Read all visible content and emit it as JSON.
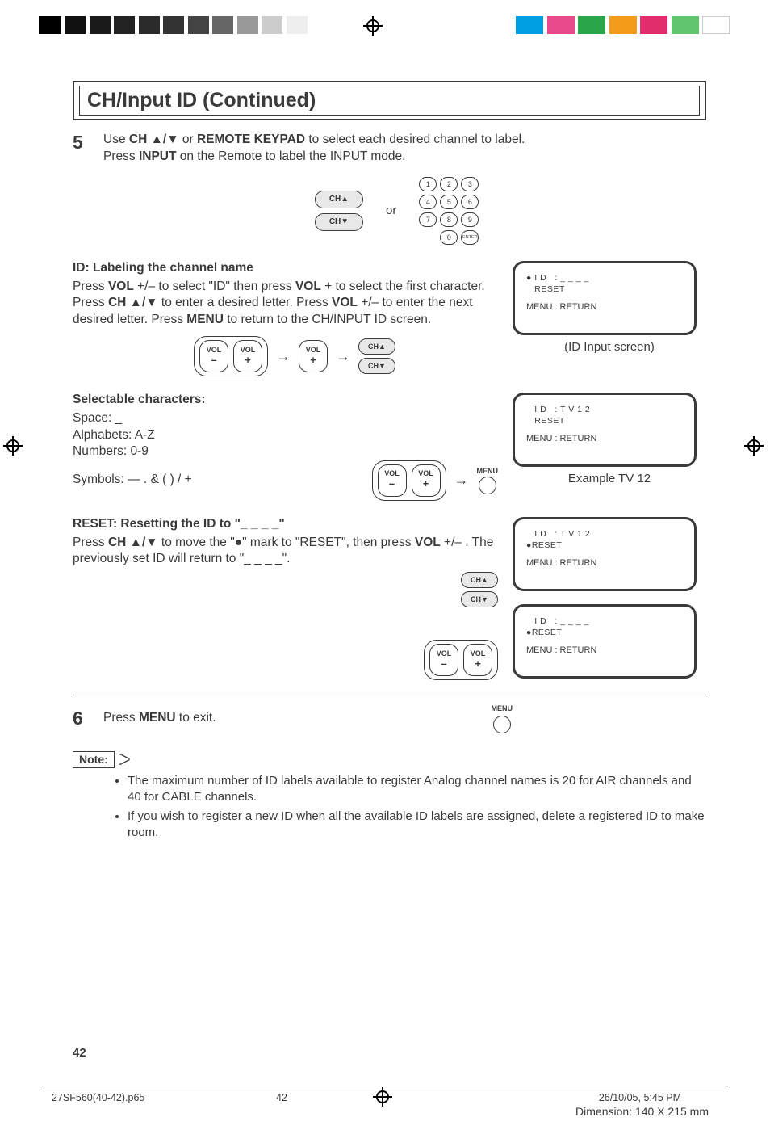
{
  "title": "CH/Input ID (Continued)",
  "step5": {
    "num": "5",
    "line1_a": "Use ",
    "line1_b": "CH ▲/▼",
    "line1_c": " or ",
    "line1_d": "REMOTE KEYPAD",
    "line1_e": " to select each desired channel to label.",
    "line2_a": "Press ",
    "line2_b": "INPUT",
    "line2_c": " on the Remote to label the INPUT mode."
  },
  "or_label": "or",
  "ch_up": "CH▲",
  "ch_dn": "CH▼",
  "keypad": [
    "1",
    "2",
    "3",
    "4",
    "5",
    "6",
    "7",
    "8",
    "9",
    "",
    "0",
    ""
  ],
  "key_enter": "ENTER",
  "id_label_heading": "ID: Labeling the channel name",
  "id_label_text_a": "Press ",
  "id_label_text_b": "VOL",
  "id_label_text_c": " +/– to select \"ID\" then press ",
  "id_label_text_d": "VOL",
  "id_label_text_e": " + to select the first character. Press ",
  "id_label_text_f": "CH ▲/▼",
  "id_label_text_g": " to enter a desired letter. Press ",
  "id_label_text_h": "VOL",
  "id_label_text_i": " +/– to enter the next desired letter. Press ",
  "id_label_text_j": "MENU",
  "id_label_text_k": " to return to the CH/INPUT ID screen.",
  "vol_label": "VOL",
  "plus": "+",
  "minus": "–",
  "screen_id_input": {
    "line1": "● I D   : _ _ _ _",
    "line2": "   RESET",
    "line3": "MENU : RETURN",
    "caption": "(ID Input screen)"
  },
  "selectable_heading": "Selectable characters:",
  "sel_space": "Space: _",
  "sel_alpha": "Alphabets: A-Z",
  "sel_num": "Numbers: 0-9",
  "sel_sym": "Symbols: — . & ( ) / +",
  "menu_label": "MENU",
  "screen_example": {
    "line1": "   I D   : T V 1 2",
    "line2": "   RESET",
    "line3": "MENU : RETURN",
    "caption": "Example TV 12"
  },
  "reset_heading": "RESET: Resetting the ID to \"_ _ _ _\"",
  "reset_text_a": "Press ",
  "reset_text_b": "CH ▲/▼",
  "reset_text_c": " to move the \"●\" mark to \"RESET\", then press ",
  "reset_text_d": "VOL",
  "reset_text_e": " +/– . The previously set ID will return to \"_ _ _ _\".",
  "screen_reset1": {
    "line1": "   I D   : T V 1 2",
    "line2": "●RESET",
    "line3": "MENU : RETURN"
  },
  "screen_reset2": {
    "line1": "   I D   : _ _ _ _",
    "line2": "●RESET",
    "line3": "MENU : RETURN"
  },
  "step6": {
    "num": "6",
    "text_a": "Press ",
    "text_b": "MENU",
    "text_c": " to exit."
  },
  "note_label": "Note:",
  "notes": [
    "The maximum number of ID labels available to register Analog channel names is 20 for AIR channels and 40 for CABLE channels.",
    "If you wish to register a new ID when all the available ID labels are assigned, delete a registered ID to make room."
  ],
  "page_number": "42",
  "footer": {
    "filename": "27SF560(40-42).p65",
    "page": "42",
    "date": "26/10/05, 5:45 PM",
    "dimension": "Dimension: 140  X 215 mm"
  }
}
